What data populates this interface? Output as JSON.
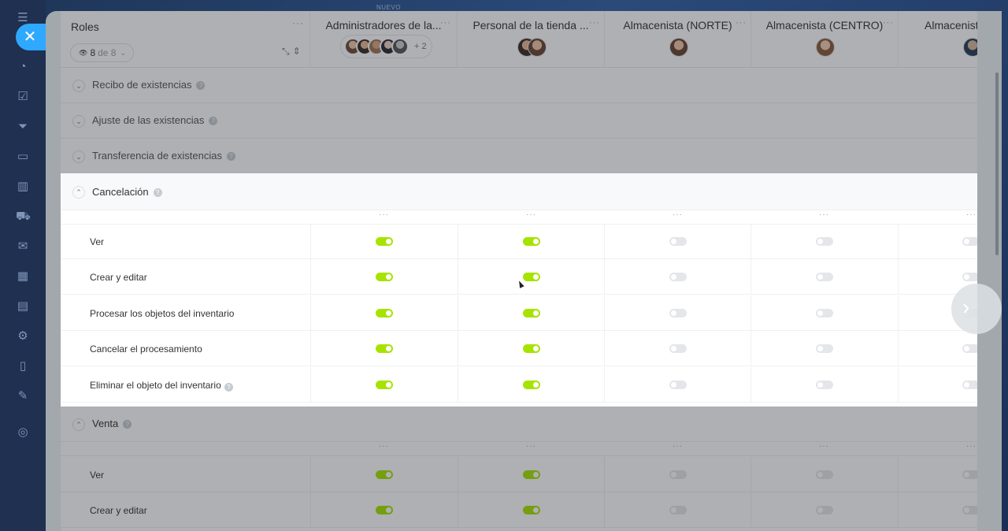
{
  "top_badge": "NUEVO",
  "header": {
    "roles_title": "Roles",
    "count": "8",
    "count_of": "de 8",
    "columns": [
      {
        "name": "Administradores de la...",
        "avatars": 5,
        "more": "+ 2"
      },
      {
        "name": "Personal de la tienda ...",
        "avatars": 2
      },
      {
        "name": "Almacenista (NORTE)",
        "avatars": 1
      },
      {
        "name": "Almacenista (CENTRO)",
        "avatars": 1
      },
      {
        "name": "Almacenist",
        "avatars": 1
      }
    ]
  },
  "sections": {
    "recibo": "Recibo de existencias",
    "ajuste": "Ajuste de las existencias",
    "transferencia": "Transferencia de existencias",
    "cancelacion": "Cancelación",
    "venta": "Venta"
  },
  "cancelacion_rows": [
    {
      "label": "Ver",
      "toggles": [
        true,
        true,
        false,
        false,
        false
      ]
    },
    {
      "label": "Crear y editar",
      "toggles": [
        true,
        true,
        false,
        false,
        false
      ]
    },
    {
      "label": "Procesar los objetos del inventario",
      "toggles": [
        true,
        true,
        false,
        false,
        false
      ]
    },
    {
      "label": "Cancelar el procesamiento",
      "toggles": [
        true,
        true,
        false,
        false,
        false
      ]
    },
    {
      "label": "Eliminar el objeto del inventario",
      "help": true,
      "toggles": [
        true,
        true,
        false,
        false,
        false
      ]
    }
  ],
  "venta_rows": [
    {
      "label": "Ver",
      "toggles": [
        true,
        true,
        false,
        false,
        false
      ]
    },
    {
      "label": "Crear y editar",
      "toggles": [
        true,
        true,
        false,
        false,
        false
      ]
    }
  ],
  "colors": {
    "toggle_on": "#a7e300",
    "toggle_off": "#e4e6e9",
    "close_button": "#2fa8ff"
  }
}
